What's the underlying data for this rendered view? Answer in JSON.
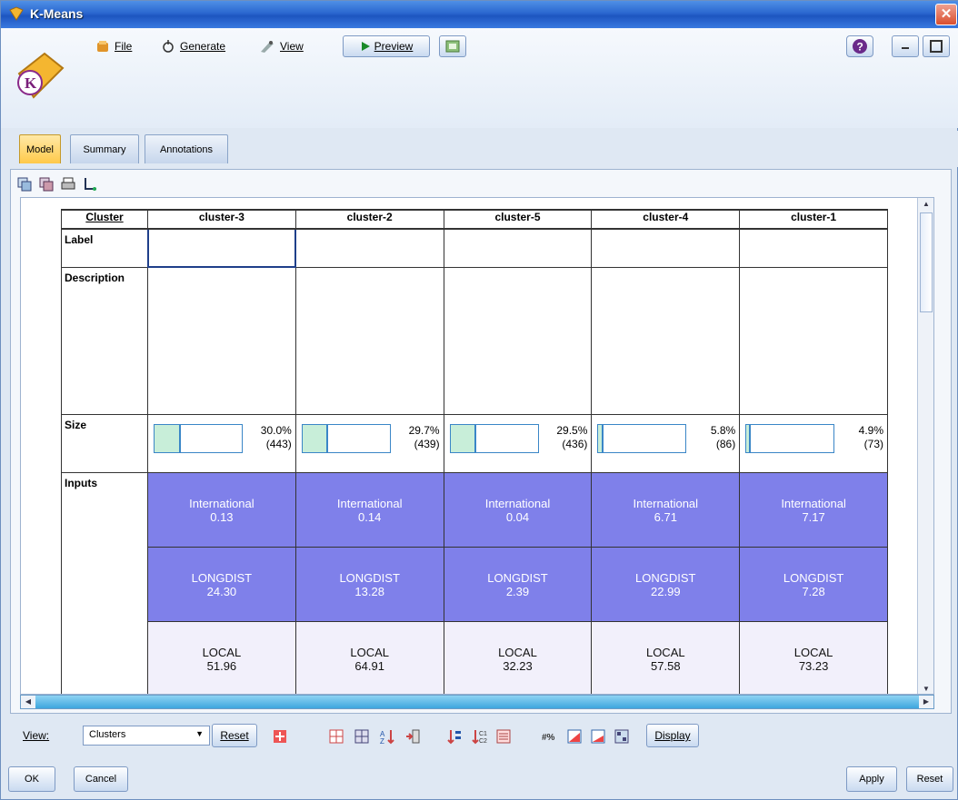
{
  "window": {
    "title": "K-Means",
    "close_glyph": "✕"
  },
  "menu": {
    "file": "File",
    "generate": "Generate",
    "view": "View"
  },
  "toolbar": {
    "preview": "Preview"
  },
  "tabs": [
    {
      "label": "Model",
      "active": true
    },
    {
      "label": "Summary"
    },
    {
      "label": "Annotations"
    }
  ],
  "table": {
    "corner": "Cluster",
    "row_labels": {
      "label": "Label",
      "description": "Description",
      "size": "Size",
      "inputs": "Inputs"
    },
    "clusters": [
      {
        "name": "cluster-3",
        "size_pct": "30.0%",
        "size_n": "(443)",
        "fill": 0.3,
        "intl_name": "International",
        "intl_val": "0.13",
        "longdist_name": "LONGDIST",
        "longdist_val": "24.30",
        "local_name": "LOCAL",
        "local_val": "51.96"
      },
      {
        "name": "cluster-2",
        "size_pct": "29.7%",
        "size_n": "(439)",
        "fill": 0.297,
        "intl_name": "International",
        "intl_val": "0.14",
        "longdist_name": "LONGDIST",
        "longdist_val": "13.28",
        "local_name": "LOCAL",
        "local_val": "64.91"
      },
      {
        "name": "cluster-5",
        "size_pct": "29.5%",
        "size_n": "(436)",
        "fill": 0.295,
        "intl_name": "International",
        "intl_val": "0.04",
        "longdist_name": "LONGDIST",
        "longdist_val": "2.39",
        "local_name": "LOCAL",
        "local_val": "32.23"
      },
      {
        "name": "cluster-4",
        "size_pct": "5.8%",
        "size_n": "(86)",
        "fill": 0.058,
        "intl_name": "International",
        "intl_val": "6.71",
        "longdist_name": "LONGDIST",
        "longdist_val": "22.99",
        "local_name": "LOCAL",
        "local_val": "57.58"
      },
      {
        "name": "cluster-1",
        "size_pct": "4.9%",
        "size_n": "(73)",
        "fill": 0.049,
        "intl_name": "International",
        "intl_val": "7.17",
        "longdist_name": "LONGDIST",
        "longdist_val": "7.28",
        "local_name": "LOCAL",
        "local_val": "73.23"
      }
    ]
  },
  "bottom": {
    "view_label": "View:",
    "view_value": "Clusters",
    "reset": "Reset",
    "display": "Display"
  },
  "footer": {
    "ok": "OK",
    "cancel": "Cancel",
    "apply": "Apply",
    "reset": "Reset"
  },
  "colors": {
    "input_dark": "#7f80ea",
    "input_light": "#f2f0fb",
    "size_fill": "#c8eed9",
    "size_border": "#3a86c7"
  }
}
